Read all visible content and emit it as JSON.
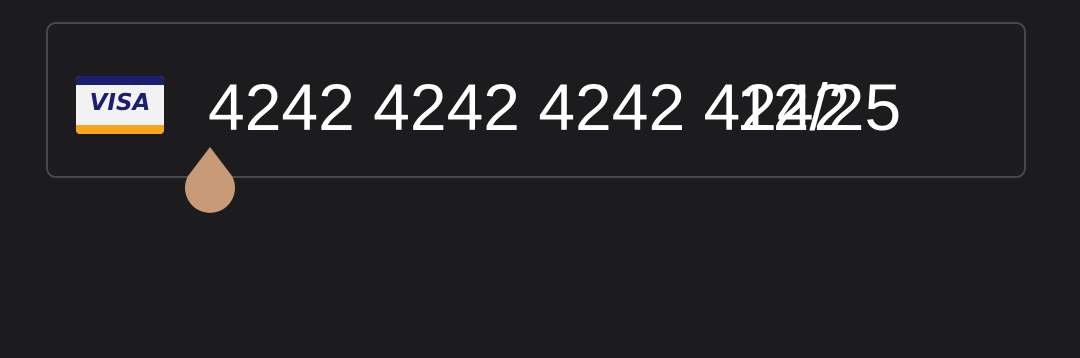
{
  "card_field": {
    "brand_icon": "visa-card-icon",
    "brand_label": "VISA",
    "card_number": "4242 4242 4242 4242",
    "expiry": "12/25"
  },
  "colors": {
    "background": "#1c1c1e",
    "field_border": "#48484a",
    "text": "#ffffff",
    "cursor_handle": "#c99a78",
    "visa_blue": "#1a1f71",
    "visa_gold": "#f7a51c"
  }
}
